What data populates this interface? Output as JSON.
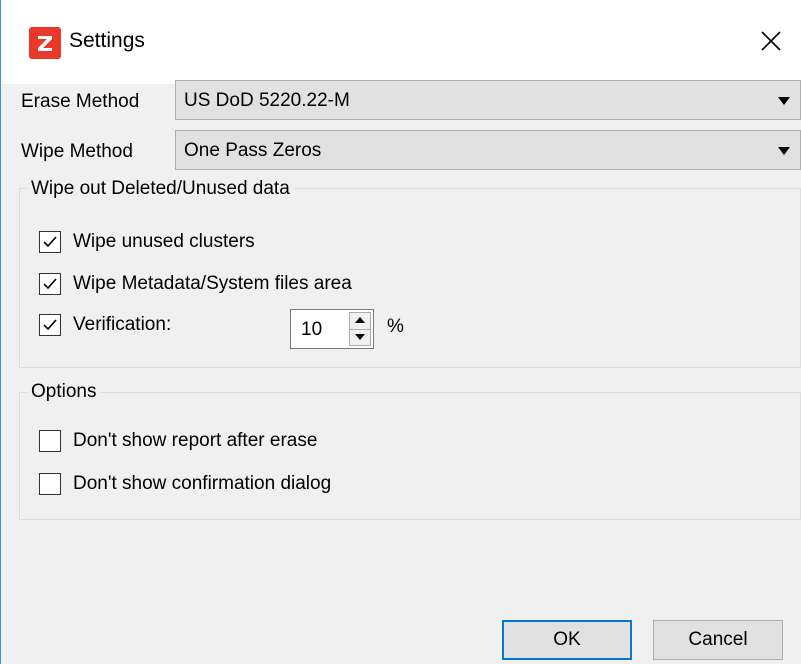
{
  "window": {
    "title": "Settings",
    "app_icon": "zeroing-app-icon",
    "close_icon": "close-icon"
  },
  "erase_method": {
    "label": "Erase Method",
    "value": "US DoD 5220.22-M"
  },
  "wipe_method": {
    "label": "Wipe Method",
    "value": "One Pass Zeros"
  },
  "wipe_group": {
    "title": "Wipe out Deleted/Unused data",
    "items": [
      {
        "label": "Wipe unused clusters",
        "checked": true
      },
      {
        "label": "Wipe Metadata/System files area",
        "checked": true
      },
      {
        "label": "Verification:",
        "checked": true
      }
    ],
    "verification_value": "10",
    "verification_unit": "%"
  },
  "options_group": {
    "title": "Options",
    "items": [
      {
        "label": "Don't show report after erase",
        "checked": false
      },
      {
        "label": "Don't show confirmation dialog",
        "checked": false
      }
    ]
  },
  "buttons": {
    "ok": "OK",
    "cancel": "Cancel"
  },
  "colors": {
    "accent": "#0078d7",
    "app_icon_bg": "#e8392b"
  }
}
